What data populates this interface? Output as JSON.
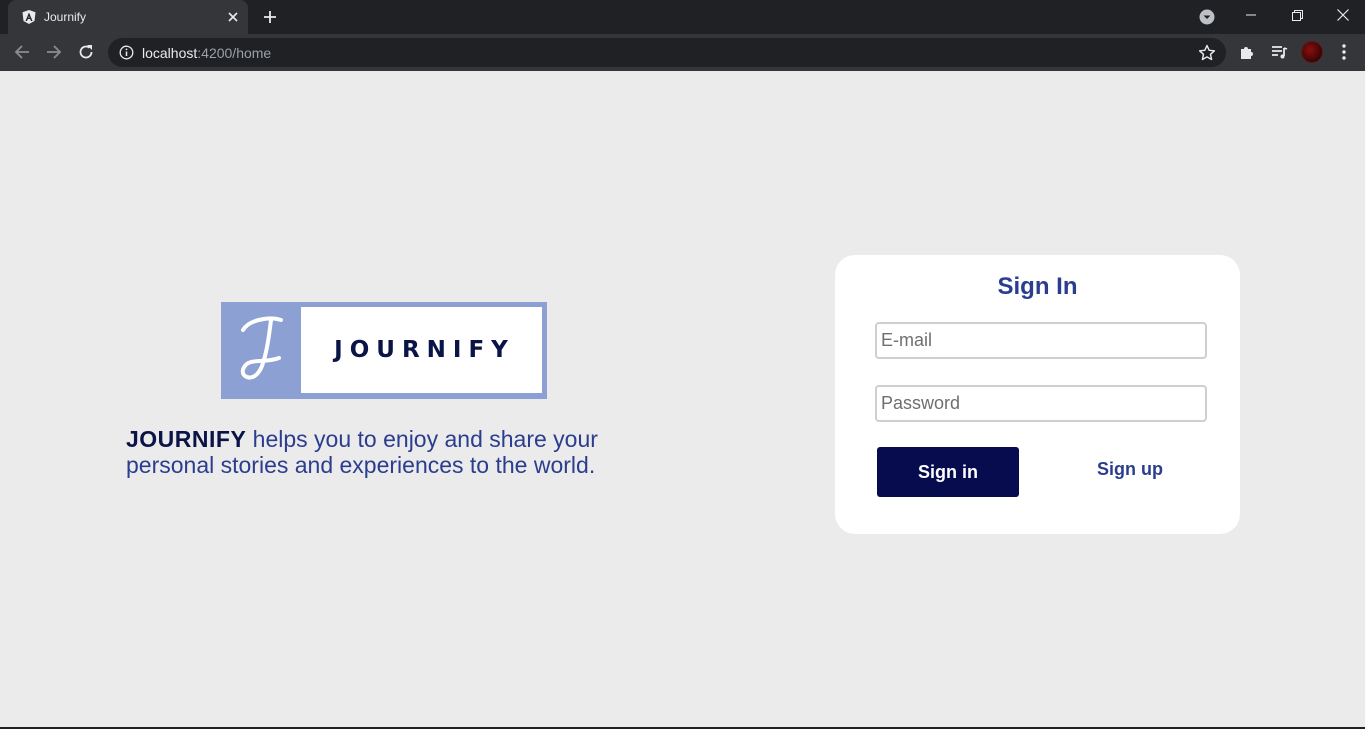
{
  "browser": {
    "tab_title": "Journify",
    "url_host": "localhost",
    "url_rest": ":4200/home"
  },
  "page": {
    "logo_text": "JOURNIFY",
    "tagline_brand": "JOURNIFY",
    "tagline_rest": " helps you to enjoy and share your personal stories and experiences to the world."
  },
  "signin": {
    "title": "Sign In",
    "email_placeholder": "E-mail",
    "password_placeholder": "Password",
    "signin_label": "Sign in",
    "signup_label": "Sign up"
  },
  "colors": {
    "brand_navy": "#070c4f",
    "brand_blue": "#2b3d8f",
    "logo_blue": "#8ca0d4",
    "page_bg": "#ebebeb"
  }
}
